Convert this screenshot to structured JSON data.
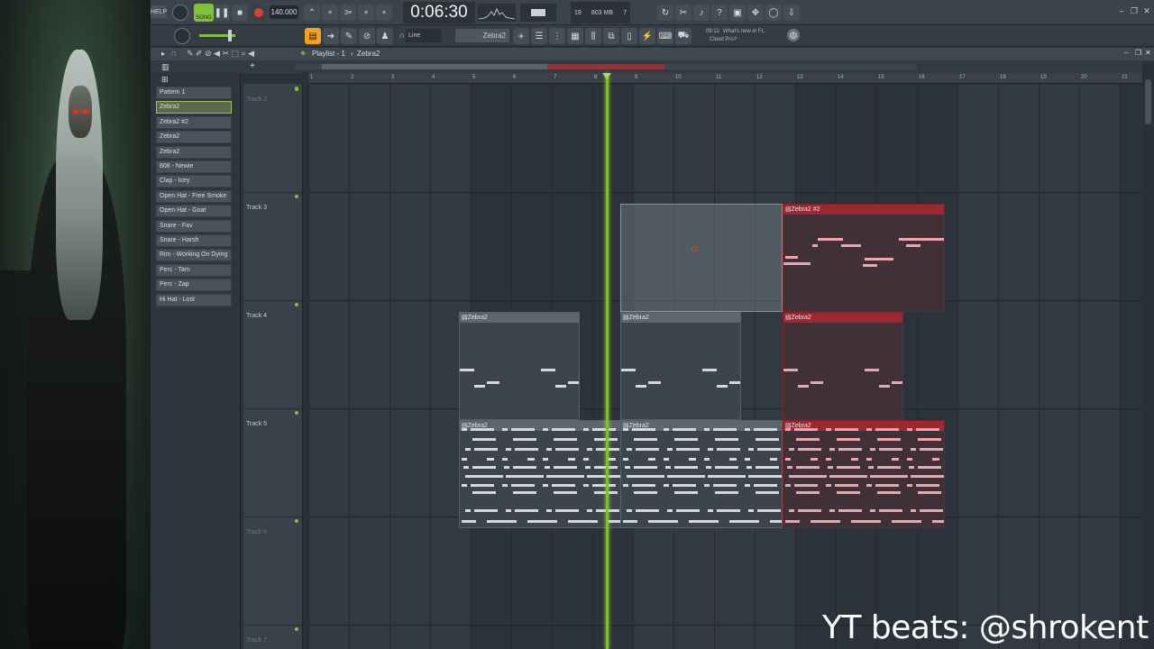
{
  "toolbar": {
    "help_label": "HELP",
    "song_label": "SONG",
    "tempo": "140.000",
    "time": "0:06:30",
    "memory": "803 MB",
    "cpu_value": "19",
    "voices": "7",
    "news_time": "09:12",
    "news_text_line1": "What's new in FL",
    "news_text_line2": "Cloud Pro?",
    "pattern_name": "Zebra2",
    "snap_label": "Line"
  },
  "playlist": {
    "title": "Playlist - 1",
    "breadcrumb_sep": "›",
    "current": "Zebra2"
  },
  "picker": {
    "items": [
      {
        "label": "Pattern 1"
      },
      {
        "label": "Zebra2"
      },
      {
        "label": "Zebra2 #2"
      },
      {
        "label": "Zebra2"
      },
      {
        "label": "Zebra2"
      },
      {
        "label": "808 - Newie"
      },
      {
        "label": "Clap - Icey"
      },
      {
        "label": "Open Hat - Free Smoke"
      },
      {
        "label": "Open Hat - Goat"
      },
      {
        "label": "Snare - Fav"
      },
      {
        "label": "Snare - Harsh"
      },
      {
        "label": "Rim - Working On Dying"
      },
      {
        "label": "Perc - Tam"
      },
      {
        "label": "Perc - Zap"
      },
      {
        "label": "Hi Hat - Lost"
      }
    ]
  },
  "tracks": [
    "Track 2",
    "Track 3",
    "Track 4",
    "Track 5",
    "Track 6",
    "Track 7"
  ],
  "ruler": [
    "1",
    "2",
    "3",
    "4",
    "5",
    "6",
    "7",
    "8",
    "9",
    "10",
    "11",
    "12",
    "13",
    "14",
    "15",
    "16",
    "17",
    "18",
    "19",
    "20",
    "21"
  ],
  "clips": {
    "t3_zebra2_2": "Zebra2 #2",
    "t4_a": "Zebra2",
    "t4_b": "Zebra2",
    "t4_c": "Zebra2",
    "t5_a": "Zebra2",
    "t5_b": "Zebra2",
    "t5_c": "Zebra2"
  },
  "watermark": "YT beats: @shrokent"
}
